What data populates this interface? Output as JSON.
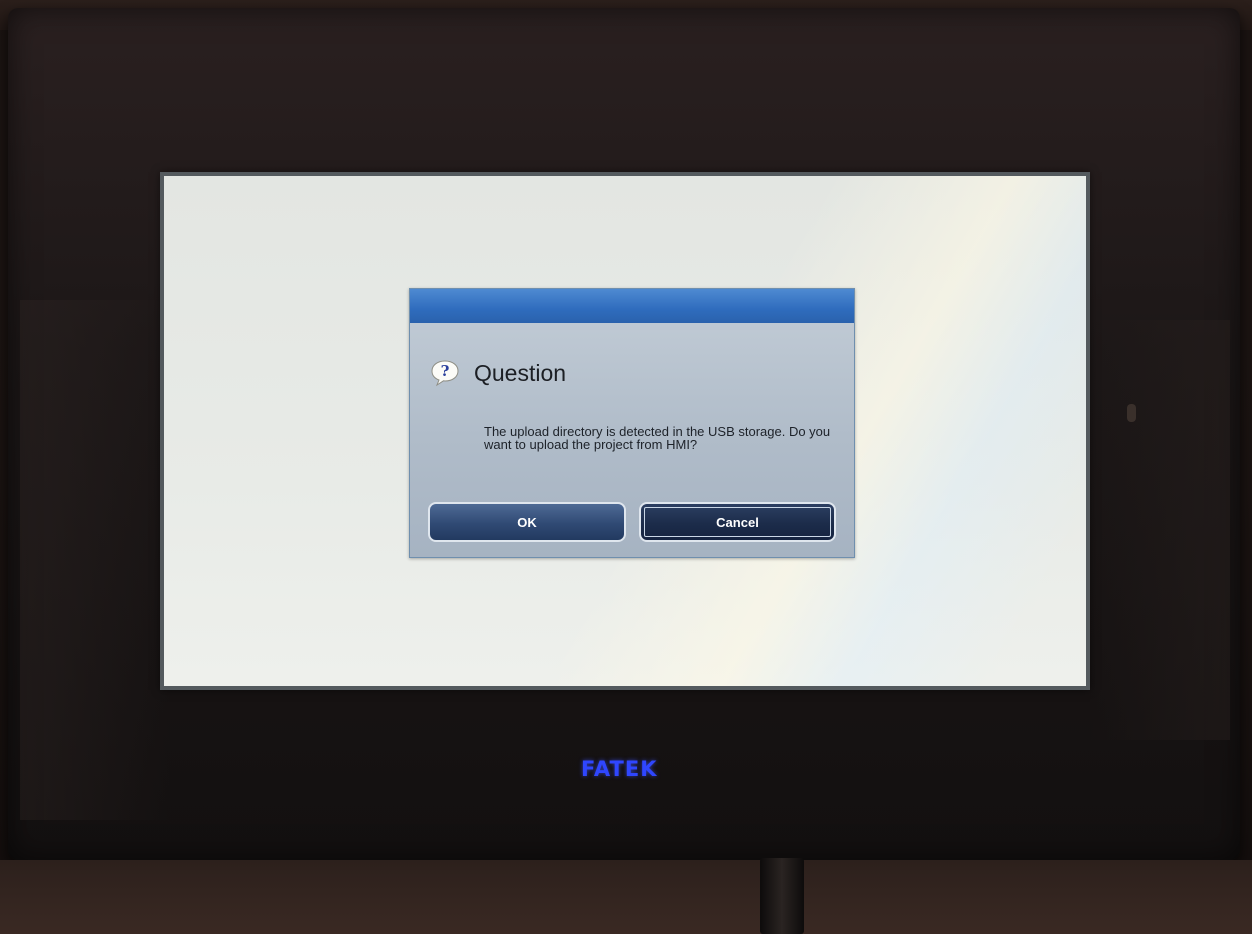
{
  "dialog": {
    "title": "Question",
    "icon": "question-bubble-icon",
    "message": "The upload directory is detected in the USB storage. Do you want to upload the project from HMI?",
    "ok_label": "OK",
    "cancel_label": "Cancel"
  },
  "device": {
    "brand_label": "FATEK",
    "brand_color": "#2f46ff"
  },
  "colors": {
    "titlebar": "#2f6cbd",
    "button_dark": "#1c2c4a",
    "screen_bg": "#e6e9e5"
  }
}
